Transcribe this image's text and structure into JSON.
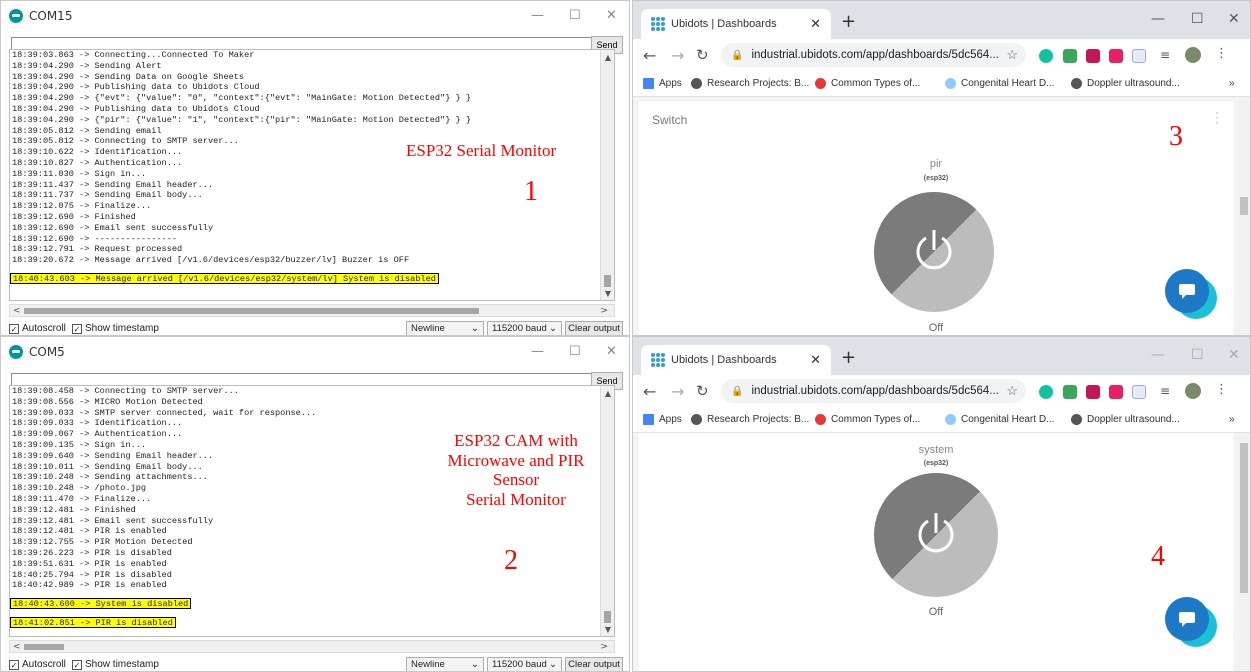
{
  "com15": {
    "title": "COM15",
    "send": "Send",
    "lines": [
      "18:39:03.863 -> Connecting...Connected To Maker",
      "18:39:04.290 -> Sending Alert",
      "18:39:04.290 -> Sending Data on Google Sheets",
      "18:39:04.290 -> Publishing data to Ubidots Cloud",
      "18:39:04.290 -> {\"evt\": {\"value\": \"0\", \"context\":{\"evt\": \"MainGate: Motion Detected\"} } }",
      "18:39:04.290 -> Publishing data to Ubidots Cloud",
      "18:39:04.290 -> {\"pir\": {\"value\": \"1\", \"context\":{\"pir\": \"MainGate: Motion Detected\"} } }",
      "18:39:05.812 -> Sending email",
      "18:39:05.812 -> Connecting to SMTP server...",
      "18:39:10.622 -> Identification...",
      "18:39:10.827 -> Authentication...",
      "18:39:11.030 -> Sign in...",
      "18:39:11.437 -> Sending Email header...",
      "18:39:11.737 -> Sending Email body...",
      "18:39:12.075 -> Finalize...",
      "18:39:12.690 -> Finished",
      "18:39:12.690 -> Email sent successfully",
      "18:39:12.690 -> ----------------",
      "18:39:12.791 -> Request processed",
      "18:39:20.672 -> Message arrived [/v1.6/devices/esp32/buzzer/lv] Buzzer is OFF"
    ],
    "highlighted": [
      "18:40:43.603 -> Message arrived [/v1.6/devices/esp32/system/lv] System is disabled"
    ],
    "autoscroll": "Autoscroll",
    "timestamp": "Show timestamp",
    "line_ending": "Newline",
    "baud": "115200 baud",
    "clear": "Clear output",
    "overlay_title": "ESP32 Serial Monitor",
    "overlay_num": "1"
  },
  "com5": {
    "title": "COM5",
    "send": "Send",
    "lines": [
      "18:39:08.458 -> Connecting to SMTP server...",
      "18:39:08.556 -> MICRO Motion Detected",
      "18:39:09.033 -> SMTP server connected, wait for response...",
      "18:39:09.033 -> Identification...",
      "18:39:09.067 -> Authentication...",
      "18:39:09.135 -> Sign in...",
      "18:39:09.640 -> Sending Email header...",
      "18:39:10.011 -> Sending Email body...",
      "18:39:10.248 -> Sending attachments...",
      "18:39:10.248 -> /photo.jpg",
      "18:39:11.470 -> Finalize...",
      "18:39:12.481 -> Finished",
      "18:39:12.481 -> Email sent successfully",
      "18:39:12.481 -> PIR is enabled",
      "18:39:12.755 -> PIR Motion Detected",
      "18:39:26.223 -> PIR is disabled",
      "18:39:51.631 -> PIR is enabled",
      "18:40:25.794 -> PIR is disabled",
      "18:40:42.989 -> PIR is enabled"
    ],
    "highlighted": [
      "18:40:43.600 -> System is disabled",
      "18:41:02.851 -> PIR is disabled"
    ],
    "autoscroll": "Autoscroll",
    "timestamp": "Show timestamp",
    "line_ending": "Newline",
    "baud": "115200 baud",
    "clear": "Clear output",
    "overlay_l1": "ESP32 CAM with",
    "overlay_l2": "Microwave and PIR",
    "overlay_l3": "Sensor",
    "overlay_l4": "Serial Monitor",
    "overlay_num": "2"
  },
  "browser": {
    "tab_title": "Ubidots | Dashboards",
    "url": "industrial.ubidots.com/app/dashboards/5dc564...",
    "bookmarks": [
      "Apps",
      "Research Projects: B...",
      "Common Types of...",
      "Congenital Heart D...",
      "Doppler ultrasound..."
    ],
    "more": "»"
  },
  "dash1": {
    "widget_title": "Switch",
    "variable": "pir",
    "device": "(esp32)",
    "state": "Off",
    "overlay_num": "3"
  },
  "dash2": {
    "variable": "system",
    "device": "(esp32)",
    "state": "Off",
    "overlay_num": "4"
  },
  "colors": {
    "highlight": "#ffff00",
    "overlay_text": "#ff0000",
    "chat_primary": "#1d78c5",
    "chat_secondary": "#1bbfd6",
    "arduino": "#00979c"
  }
}
